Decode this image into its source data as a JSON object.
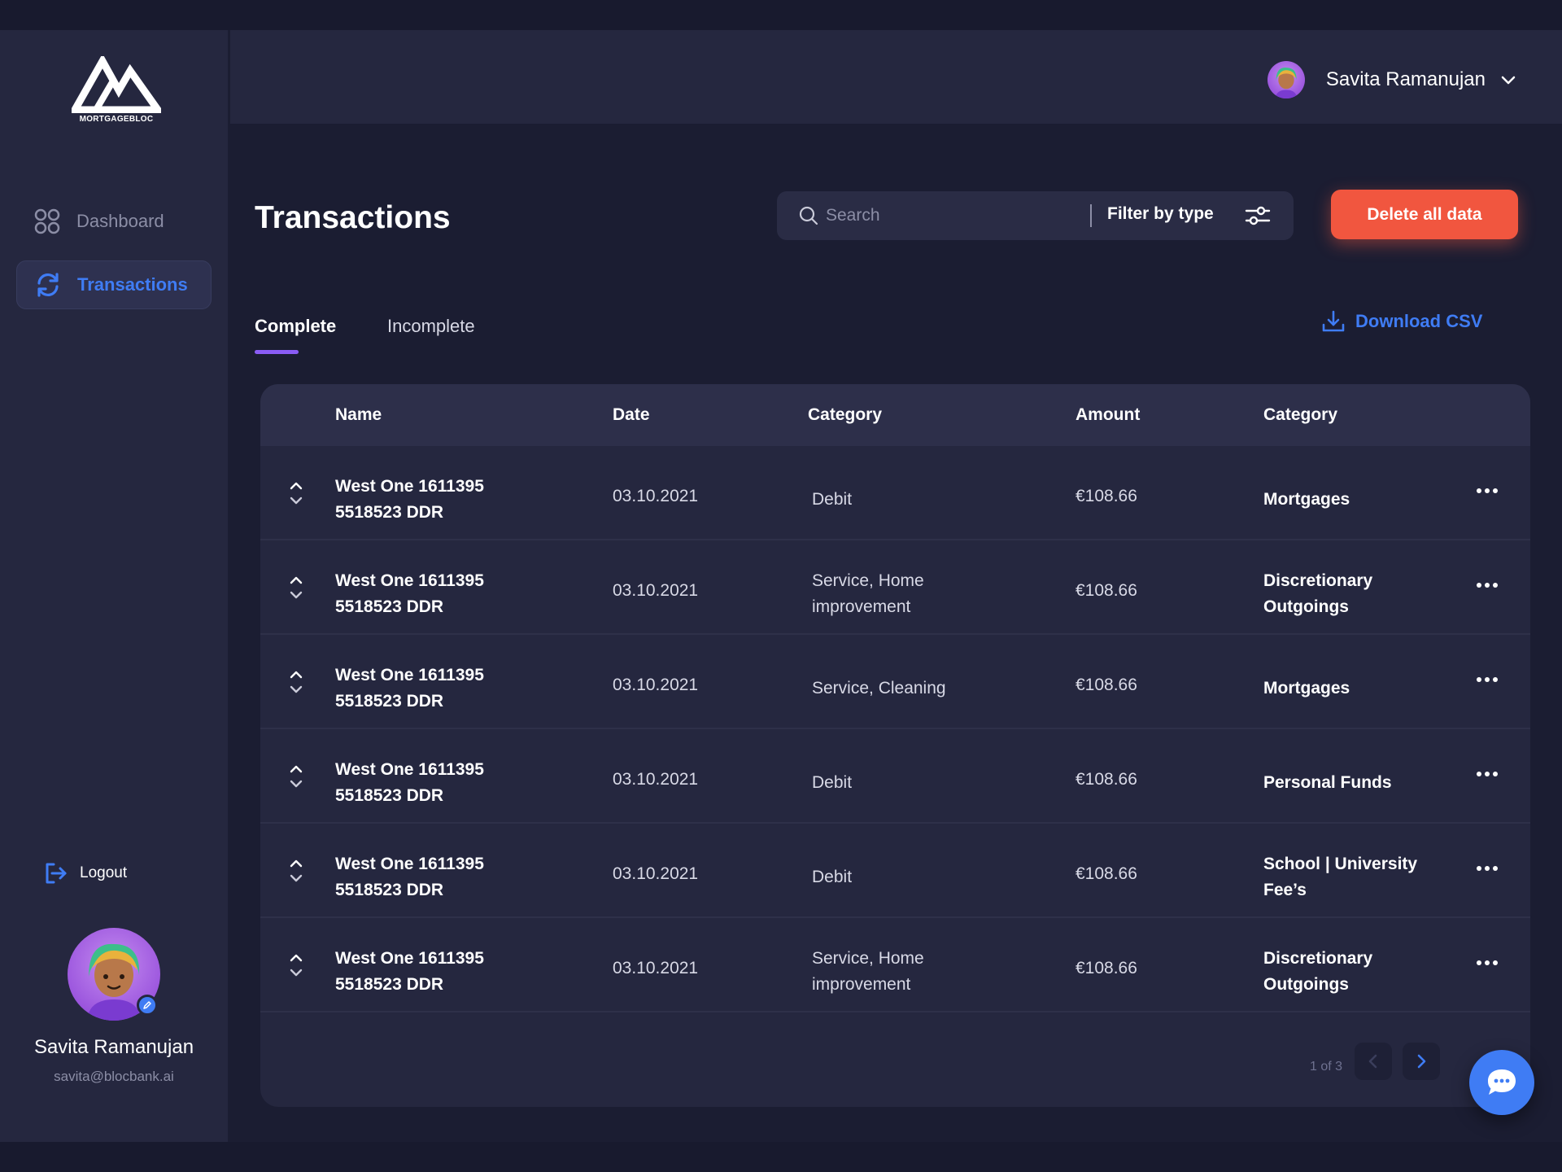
{
  "app": {
    "logo_text": "MORTGAGEBLOC",
    "accent": "#3f7cf4",
    "danger": "#f1563f",
    "tab_indicator": "#8a5cf5"
  },
  "sidebar": {
    "items": [
      {
        "label": "Dashboard",
        "icon": "grid-icon",
        "active": false
      },
      {
        "label": "Transactions",
        "icon": "refresh-icon",
        "active": true
      }
    ],
    "logout_label": "Logout",
    "user": {
      "name": "Savita Ramanujan",
      "email": "savita@blocbank.ai"
    }
  },
  "header": {
    "user_name": "Savita Ramanujan"
  },
  "main": {
    "title": "Transactions",
    "search_placeholder": "Search",
    "filter_label": "Filter by type",
    "delete_label": "Delete all data",
    "tabs": [
      {
        "label": "Complete",
        "active": true
      },
      {
        "label": "Incomplete",
        "active": false
      }
    ],
    "download_label": "Download CSV"
  },
  "table": {
    "columns": [
      "Name",
      "Date",
      "Category",
      "Amount",
      "Category"
    ],
    "rows": [
      {
        "name": "West One 1611395 5518523 DDR",
        "date": "03.10.2021",
        "type": "Debit",
        "amount": "€108.66",
        "category": "Mortgages"
      },
      {
        "name": "West One 1611395 5518523 DDR",
        "date": "03.10.2021",
        "type": "Service, Home improvement",
        "amount": "€108.66",
        "category": "Discretionary Outgoings"
      },
      {
        "name": "West One 1611395 5518523 DDR",
        "date": "03.10.2021",
        "type": "Service, Cleaning",
        "amount": "€108.66",
        "category": "Mortgages"
      },
      {
        "name": "West One 1611395 5518523 DDR",
        "date": "03.10.2021",
        "type": "Debit",
        "amount": "€108.66",
        "category": "Personal Funds"
      },
      {
        "name": "West One 1611395 5518523 DDR",
        "date": "03.10.2021",
        "type": "Debit",
        "amount": "€108.66",
        "category": "School | University Fee’s"
      },
      {
        "name": "West One 1611395 5518523 DDR",
        "date": "03.10.2021",
        "type": "Service, Home improvement",
        "amount": "€108.66",
        "category": "Discretionary Outgoings"
      }
    ],
    "pagination": {
      "text": "1 of 3"
    }
  }
}
